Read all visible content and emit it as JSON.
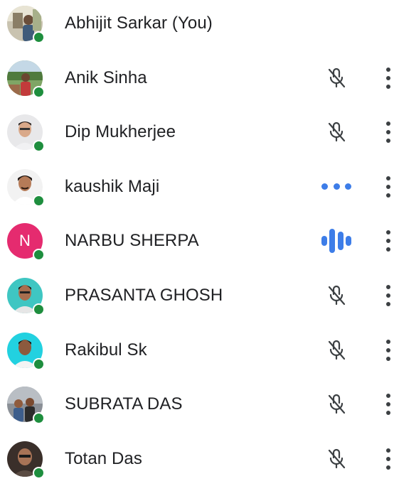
{
  "participants": [
    {
      "name": "Abhijit Sarkar (You)",
      "avatar": "photo",
      "mic": "none",
      "online": true
    },
    {
      "name": "Anik Sinha",
      "avatar": "photo",
      "mic": "muted",
      "online": true
    },
    {
      "name": "Dip Mukherjee",
      "avatar": "photo",
      "mic": "muted",
      "online": true
    },
    {
      "name": "kaushik Maji",
      "avatar": "photo",
      "mic": "speaking-low",
      "online": true
    },
    {
      "name": "NARBU SHERPA",
      "avatar": "letter",
      "initial": "N",
      "avatar_color": "#e52b6f",
      "mic": "speaking-high",
      "online": true
    },
    {
      "name": "PRASANTA GHOSH",
      "avatar": "photo",
      "mic": "muted",
      "online": true
    },
    {
      "name": "Rakibul Sk",
      "avatar": "photo",
      "mic": "muted",
      "online": true
    },
    {
      "name": "SUBRATA DAS",
      "avatar": "photo",
      "mic": "muted",
      "online": true
    },
    {
      "name": "Totan Das",
      "avatar": "photo",
      "mic": "muted",
      "online": true
    }
  ],
  "icons": {
    "muted": "mic-off-icon",
    "speaking": "audio-level-icon",
    "more": "more-vert-icon",
    "online": "online-status-dot"
  },
  "colors": {
    "speaking": "#3d7de8",
    "online": "#1e8e3e",
    "muted_icon": "#3c4043"
  }
}
